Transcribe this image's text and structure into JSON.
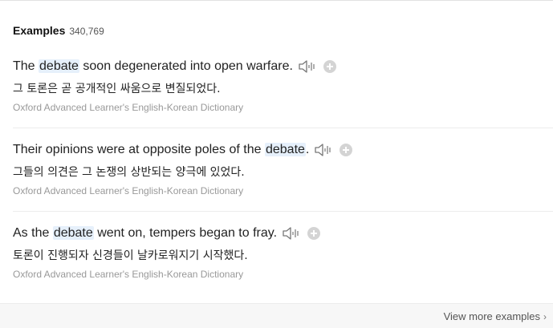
{
  "header": {
    "title": "Examples",
    "count": "340,769"
  },
  "examples": [
    {
      "before": "The ",
      "keyword": "debate",
      "after": " soon degenerated into open warfare.",
      "translation": "그 토론은 곧 공개적인 싸움으로 변질되었다.",
      "source": "Oxford Advanced Learner's English-Korean Dictionary"
    },
    {
      "before": "Their opinions were at opposite poles of the ",
      "keyword": "debate",
      "after": ".",
      "translation": "그들의 의견은 그 논쟁의 상반되는 양극에 있었다.",
      "source": "Oxford Advanced Learner's English-Korean Dictionary"
    },
    {
      "before": "As the ",
      "keyword": "debate",
      "after": " went on, tempers began to fray.",
      "translation": "토론이 진행되자 신경들이 날카로워지기 시작했다.",
      "source": "Oxford Advanced Learner's English-Korean Dictionary"
    }
  ],
  "footer": {
    "view_more": "View more examples",
    "chevron": "›"
  },
  "icons": {
    "speaker": "speaker-icon",
    "add": "plus-circle-icon"
  },
  "colors": {
    "highlight": "#e6f0fb",
    "source_text": "#999999",
    "icon_gray": "#d4d4d4"
  }
}
